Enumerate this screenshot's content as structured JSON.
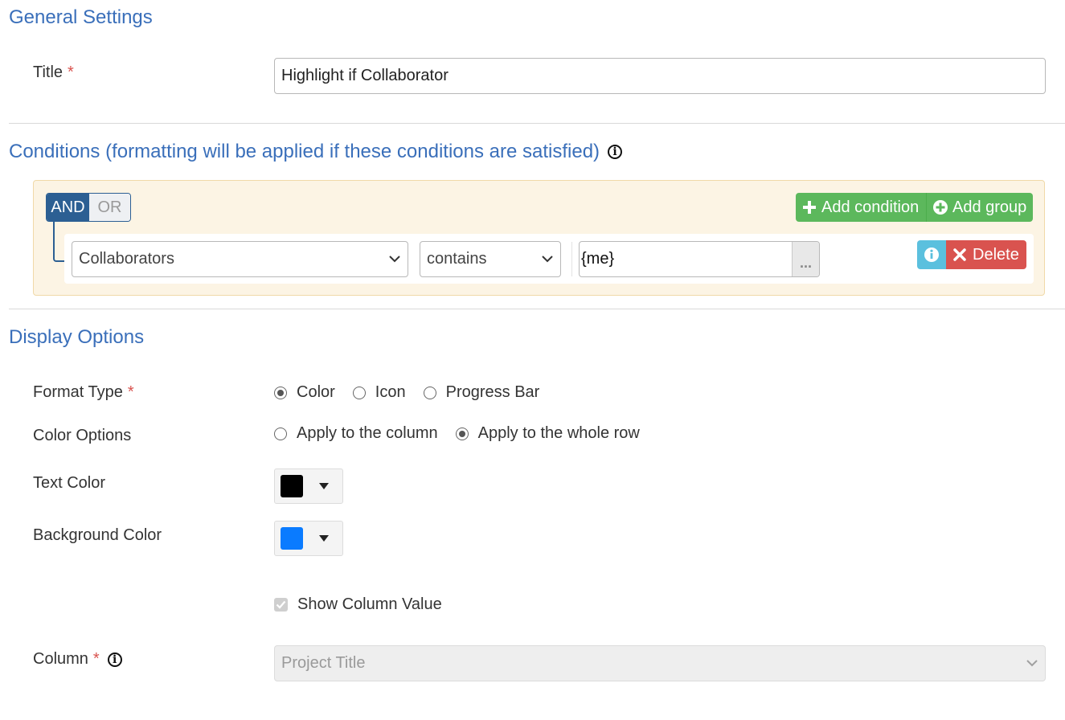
{
  "general": {
    "heading": "General Settings",
    "title_label": "Title",
    "required_mark": "*",
    "title_value": "Highlight if Collaborator"
  },
  "conditions": {
    "heading": "Conditions (formatting will be applied if these conditions are satisfied)",
    "info_icon": "info-circle-icon",
    "logic": {
      "and_label": "AND",
      "or_label": "OR",
      "selected": "AND"
    },
    "add_condition_label": "Add condition",
    "add_group_label": "Add group",
    "rule": {
      "field": "Collaborators",
      "operator": "contains",
      "value": "{me}",
      "ellipsis": "...",
      "delete_label": "Delete"
    },
    "colors": {
      "and": "#2c5f93",
      "add": "#5cb85c",
      "info": "#5bc0de",
      "delete": "#d9534f",
      "panel_bg": "#fcf4e4"
    }
  },
  "display": {
    "heading": "Display Options",
    "format_type": {
      "label": "Format Type",
      "options": [
        "Color",
        "Icon",
        "Progress Bar"
      ],
      "selected": "Color"
    },
    "color_options": {
      "label": "Color Options",
      "options": [
        "Apply to the column",
        "Apply to the whole row"
      ],
      "selected": "Apply to the whole row"
    },
    "text_color": {
      "label": "Text Color",
      "value": "#000000"
    },
    "background_color": {
      "label": "Background Color",
      "value": "#0a7bff"
    },
    "show_column_value": {
      "label": "Show Column Value",
      "checked": true
    },
    "column": {
      "label": "Column",
      "value": "Project Title"
    }
  },
  "accent_color": "#3a6fba"
}
